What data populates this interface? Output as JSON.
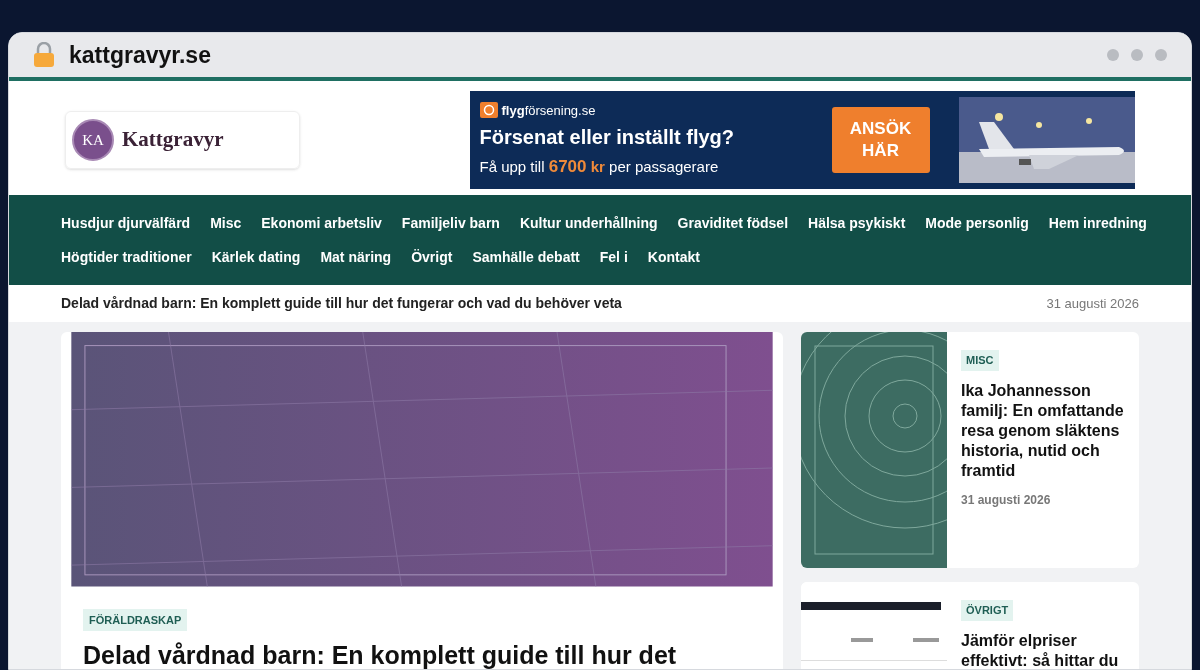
{
  "browser": {
    "address": "kattgravyr.se"
  },
  "logo": {
    "initials": "KA",
    "name": "Kattgravyr"
  },
  "ad": {
    "brand_bold": "flyg",
    "brand_rest": "försening.se",
    "headline": "Försenat eller inställt flyg?",
    "subline_start": "Få upp till",
    "amount": "6700",
    "currency": "kr",
    "subline_end": "per passagerare",
    "button": "ANSÖK HÄR"
  },
  "nav": {
    "items": [
      "Husdjur djurvälfärd",
      "Misc",
      "Ekonomi arbetsliv",
      "Familjeliv barn",
      "Kultur underhållning",
      "Graviditet födsel",
      "Hälsa psykiskt",
      "Mode personlig",
      "Hem inredning",
      "Högtider traditioner",
      "Kärlek dating",
      "Mat näring",
      "Övrigt",
      "Samhälle debatt",
      "Fel i",
      "Kontakt"
    ]
  },
  "ticker": {
    "headline": "Delad vårdnad barn: En komplett guide till hur det fungerar och vad du behöver veta",
    "date": "31 augusti 2026"
  },
  "featured": {
    "category": "FÖRÄLDRASKAP",
    "title": "Delad vårdnad barn: En komplett guide till hur det"
  },
  "sidebar": [
    {
      "category": "MISC",
      "title": "Ika Johannesson familj: En omfattande resa genom släktens historia, nutid och framtid",
      "date": "31 augusti 2026"
    },
    {
      "category": "ÖVRIGT",
      "title": "Jämför elpriser effektivt: så hittar du"
    }
  ]
}
